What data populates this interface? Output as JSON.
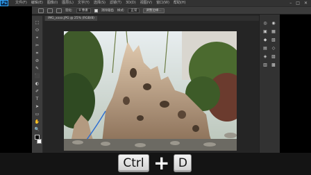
{
  "app": {
    "logo": "Ps"
  },
  "menu": [
    {
      "label": "文件(F)"
    },
    {
      "label": "编辑(E)"
    },
    {
      "label": "图像(I)"
    },
    {
      "label": "图层(L)"
    },
    {
      "label": "文字(Y)"
    },
    {
      "label": "选择(S)"
    },
    {
      "label": "滤镜(T)"
    },
    {
      "label": "3D(D)"
    },
    {
      "label": "视图(V)"
    },
    {
      "label": "窗口(W)"
    },
    {
      "label": "帮助(H)"
    }
  ],
  "window_controls": {
    "minimize": "–",
    "maximize": "□",
    "close": "✕"
  },
  "options": {
    "feather_label": "羽化:",
    "feather_value": "0 像素",
    "antialias_label": "消除锯齿",
    "style_label": "样式:",
    "style_value": "正常",
    "refine_edge": "调整边缘..."
  },
  "document": {
    "tab_label": "IMG_xxxx.JPG @ 25% (RGB/8)"
  },
  "tools": [
    "⬚",
    "⬭",
    "⌖",
    "✂",
    "⌗",
    "⊘",
    "✎",
    "⬛",
    "◐",
    "✐",
    "T",
    "➤",
    "▭",
    "✋",
    "🔍"
  ],
  "panel_icons": [
    "◎",
    "▣",
    "◆",
    "▤",
    "◈",
    "▥",
    "◉",
    "▦",
    "▧",
    "◇",
    "▨",
    "▩"
  ],
  "shortcut": {
    "modifier": "Ctrl",
    "plus": "+",
    "key": "D"
  },
  "colors": {
    "accent": "#31a8ff",
    "ui_bg": "#323232",
    "canvas_bg": "#252525"
  }
}
